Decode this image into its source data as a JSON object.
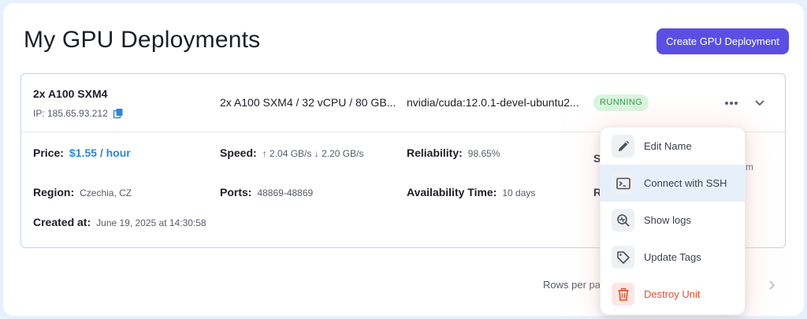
{
  "page": {
    "title": "My GPU Deployments",
    "create_button": "Create GPU Deployment"
  },
  "deployment": {
    "name": "2x A100 SXM4",
    "ip": "IP: 185.65.93.212",
    "spec": "2x A100 SXM4 / 32 vCPU / 80 GB...",
    "image": "nvidia/cuda:12.0.1-devel-ubuntu2...",
    "status": "RUNNING",
    "price_label": "Price:",
    "price_value": "$1.55 / hour",
    "speed_label": "Speed:",
    "speed_up": "2.04 GB/s",
    "speed_down": "2.20 GB/s",
    "reliability_label": "Reliability:",
    "reliability_value": "98.65%",
    "region_label": "Region:",
    "region_value": "Czechia, CZ",
    "ports_label": "Ports:",
    "ports_value": "48869-48869",
    "availability_label": "Availability Time:",
    "availability_value": "10 days",
    "created_label": "Created at:",
    "created_value": "June 19, 2025 at 14:30:58",
    "hidden_s": "S",
    "hidden_r": "R",
    "hidden_m": "m"
  },
  "pagination": {
    "rows_per_page": "Rows per pa"
  },
  "menu": {
    "items": [
      {
        "label": "Edit Name",
        "icon": "pencil-icon"
      },
      {
        "label": "Connect with SSH",
        "icon": "terminal-icon"
      },
      {
        "label": "Show logs",
        "icon": "logs-search-icon"
      },
      {
        "label": "Update Tags",
        "icon": "tag-icon"
      },
      {
        "label": "Destroy Unit",
        "icon": "trash-icon"
      }
    ]
  },
  "colors": {
    "accent": "#5b4fe3",
    "price": "#2d86d6",
    "running_bg": "#d9f5df",
    "running_fg": "#2d9a4a",
    "danger": "#e0502f"
  }
}
